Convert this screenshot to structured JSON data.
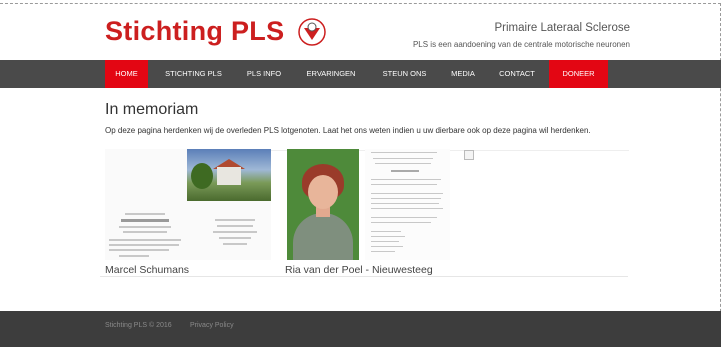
{
  "header": {
    "logo_text": "Stichting PLS",
    "tagline_title": "Primaire Lateraal Sclerose",
    "tagline_sub": "PLS is een aandoening van de centrale motorische neuronen"
  },
  "nav": {
    "items": [
      {
        "label": "HOME",
        "active": true
      },
      {
        "label": "STICHTING PLS"
      },
      {
        "label": "PLS INFO"
      },
      {
        "label": "ERVARINGEN"
      },
      {
        "label": "STEUN ONS"
      },
      {
        "label": "MEDIA"
      },
      {
        "label": "CONTACT"
      },
      {
        "label": "DONEER",
        "highlight": true
      }
    ]
  },
  "page": {
    "title": "In memoriam",
    "intro": "Op deze pagina herdenken wij de overleden PLS lotgenoten. Laat het ons weten indien u uw dierbare ook op deze pagina wil herdenken."
  },
  "memorials": [
    {
      "name": "Marcel Schumans"
    },
    {
      "name": "Ria van der Poel - Nieuwesteeg"
    }
  ],
  "footer": {
    "copyright": "Stichting PLS © 2016",
    "privacy": "Privacy Policy"
  },
  "colors": {
    "brand_red": "#cc1f1f",
    "nav_bg": "#4a4a4a",
    "nav_active": "#e30613",
    "footer_bg": "#3d3d3d"
  }
}
